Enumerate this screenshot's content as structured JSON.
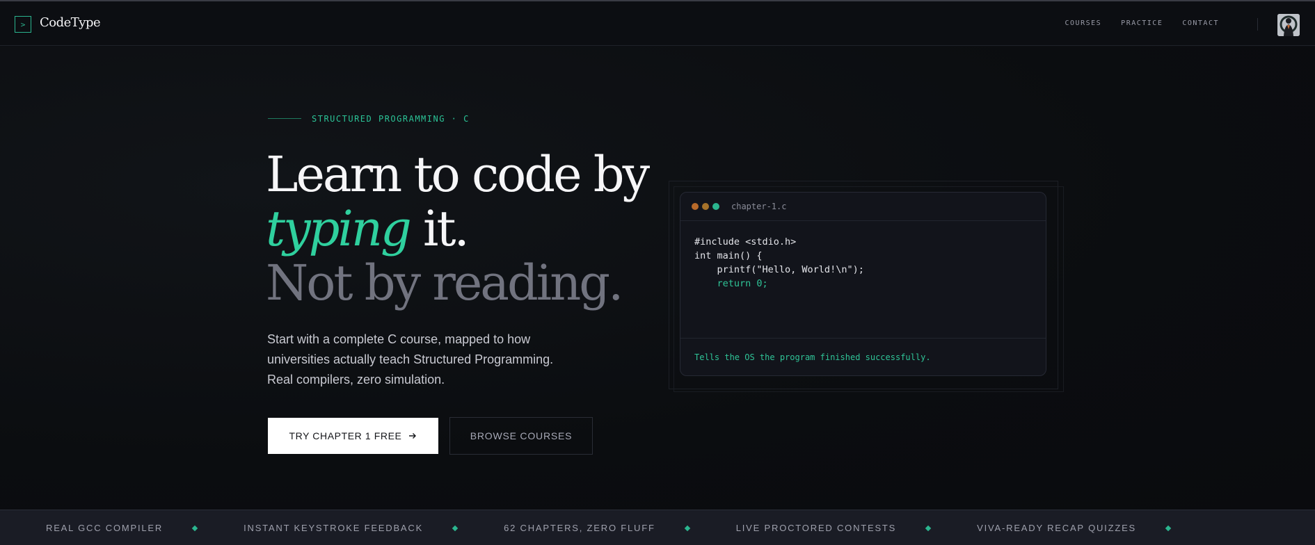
{
  "nav": {
    "brand_mark": ">",
    "brand_name": "CodeType",
    "links": [
      {
        "label": "COURSES"
      },
      {
        "label": "PRACTICE"
      },
      {
        "label": "CONTACT"
      }
    ]
  },
  "hero": {
    "eyebrow": "STRUCTURED PROGRAMMING · C",
    "headline": {
      "line1": "Learn to code by",
      "accent_word": "typing",
      "line2_rest": " it.",
      "line3": "Not by reading."
    },
    "lede": "Start with a complete C course, mapped to how universities actually teach Structured Programming. Real compilers, zero simulation.",
    "primary_cta": "TRY CHAPTER 1 FREE",
    "secondary_cta": "BROWSE COURSES"
  },
  "code_card": {
    "filename": "chapter-1.c",
    "lines": [
      "#include <stdio.h>",
      "int main() {",
      "    printf(\"Hello, World!\\n\");",
      "    return 0;"
    ],
    "caption": "Tells the OS the program finished successfully.",
    "dot_colors": [
      "#b86a2a",
      "#a6722a",
      "#2bb58f"
    ]
  },
  "ticker": {
    "items": [
      "REAL GCC COMPILER",
      "INSTANT KEYSTROKE FEEDBACK",
      "62 CHAPTERS, ZERO FLUFF",
      "LIVE PROCTORED CONTESTS",
      "VIVA-READY RECAP QUIZZES"
    ]
  },
  "colors": {
    "accent": "#2fd09e",
    "background": "#0c0e12"
  }
}
